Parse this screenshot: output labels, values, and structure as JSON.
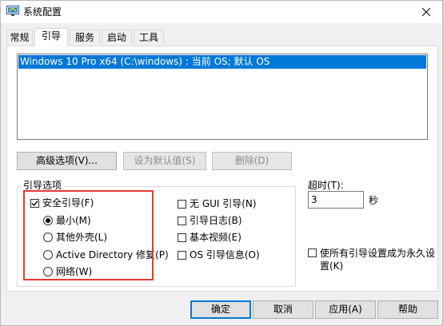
{
  "window": {
    "title": "系统配置"
  },
  "tabs": [
    {
      "label": "常规",
      "active": false
    },
    {
      "label": "引导",
      "active": true
    },
    {
      "label": "服务",
      "active": false
    },
    {
      "label": "启动",
      "active": false
    },
    {
      "label": "工具",
      "active": false
    }
  ],
  "boot_list": {
    "selected_entry": "Windows 10 Pro x64 (C:\\windows) : 当前 OS; 默认 OS"
  },
  "actions": {
    "advanced": "高级选项(V)...",
    "set_default": "设为默认值(S)",
    "delete": "删除(D)"
  },
  "boot_options": {
    "group_label": "引导选项",
    "safe_boot": {
      "label": "安全引导(F)",
      "checked": true
    },
    "safe_modes": [
      {
        "label": "最小(M)",
        "selected": true
      },
      {
        "label": "其他外壳(L)",
        "selected": false
      },
      {
        "label": "Active Directory 修复(P)",
        "selected": false
      },
      {
        "label": "网络(W)",
        "selected": false
      }
    ],
    "no_gui": {
      "label": "无 GUI 引导(N)",
      "checked": false
    },
    "boot_log": {
      "label": "引导日志(B)",
      "checked": false
    },
    "base_video": {
      "label": "基本视频(E)",
      "checked": false
    },
    "os_info": {
      "label": "OS 引导信息(O)",
      "checked": false
    }
  },
  "timeout": {
    "label": "超时(T):",
    "value": "3",
    "unit": "秒"
  },
  "permanent": {
    "label": "使所有引导设置成为永久设置(K)",
    "checked": false
  },
  "footer": {
    "ok": "确定",
    "cancel": "取消",
    "apply": "应用(A)",
    "help": "帮助"
  },
  "colors": {
    "selection": "#0078d7",
    "highlight_box": "#e53935"
  }
}
